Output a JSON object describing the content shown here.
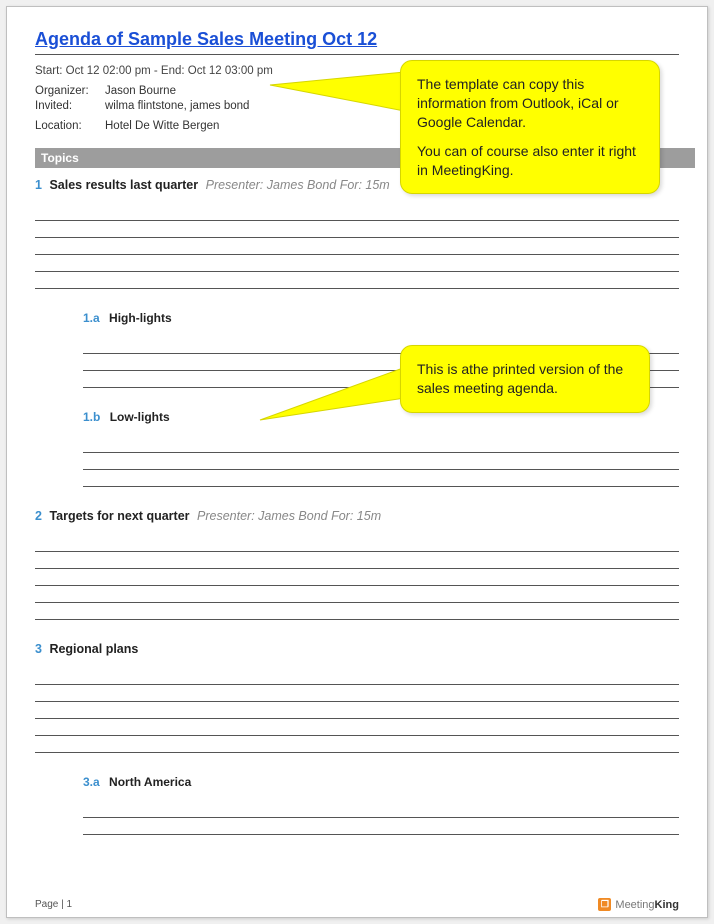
{
  "title": "Agenda of Sample Sales Meeting Oct 12",
  "datetime_line": "Start: Oct 12 02:00 pm - End: Oct 12 03:00 pm",
  "organizer_label": "Organizer:",
  "organizer_value": "Jason Bourne",
  "invited_label": "Invited:",
  "invited_value": "wilma flintstone, james bond",
  "location_label": "Location:",
  "location_value": "Hotel De Witte Bergen",
  "section_header": "Topics",
  "topics": {
    "t1": {
      "num": "1",
      "title": "Sales results last quarter",
      "presenter": "Presenter: James Bond For: 15m"
    },
    "t1a": {
      "num": "1.a",
      "title": "High-lights"
    },
    "t1b": {
      "num": "1.b",
      "title": "Low-lights"
    },
    "t2": {
      "num": "2",
      "title": "Targets for next quarter",
      "presenter": "Presenter: James Bond For: 15m"
    },
    "t3": {
      "num": "3",
      "title": "Regional plans"
    },
    "t3a": {
      "num": "3.a",
      "title": "North America"
    }
  },
  "footer_page": "Page | 1",
  "brand_prefix": "Meeting",
  "brand_suffix": "King",
  "callout1_p1": "The template can copy this information from Outlook, iCal or Google Calendar.",
  "callout1_p2": "You can of course also enter it right in MeetingKing.",
  "callout2_p1": "This is athe printed version of the sales meeting agenda."
}
